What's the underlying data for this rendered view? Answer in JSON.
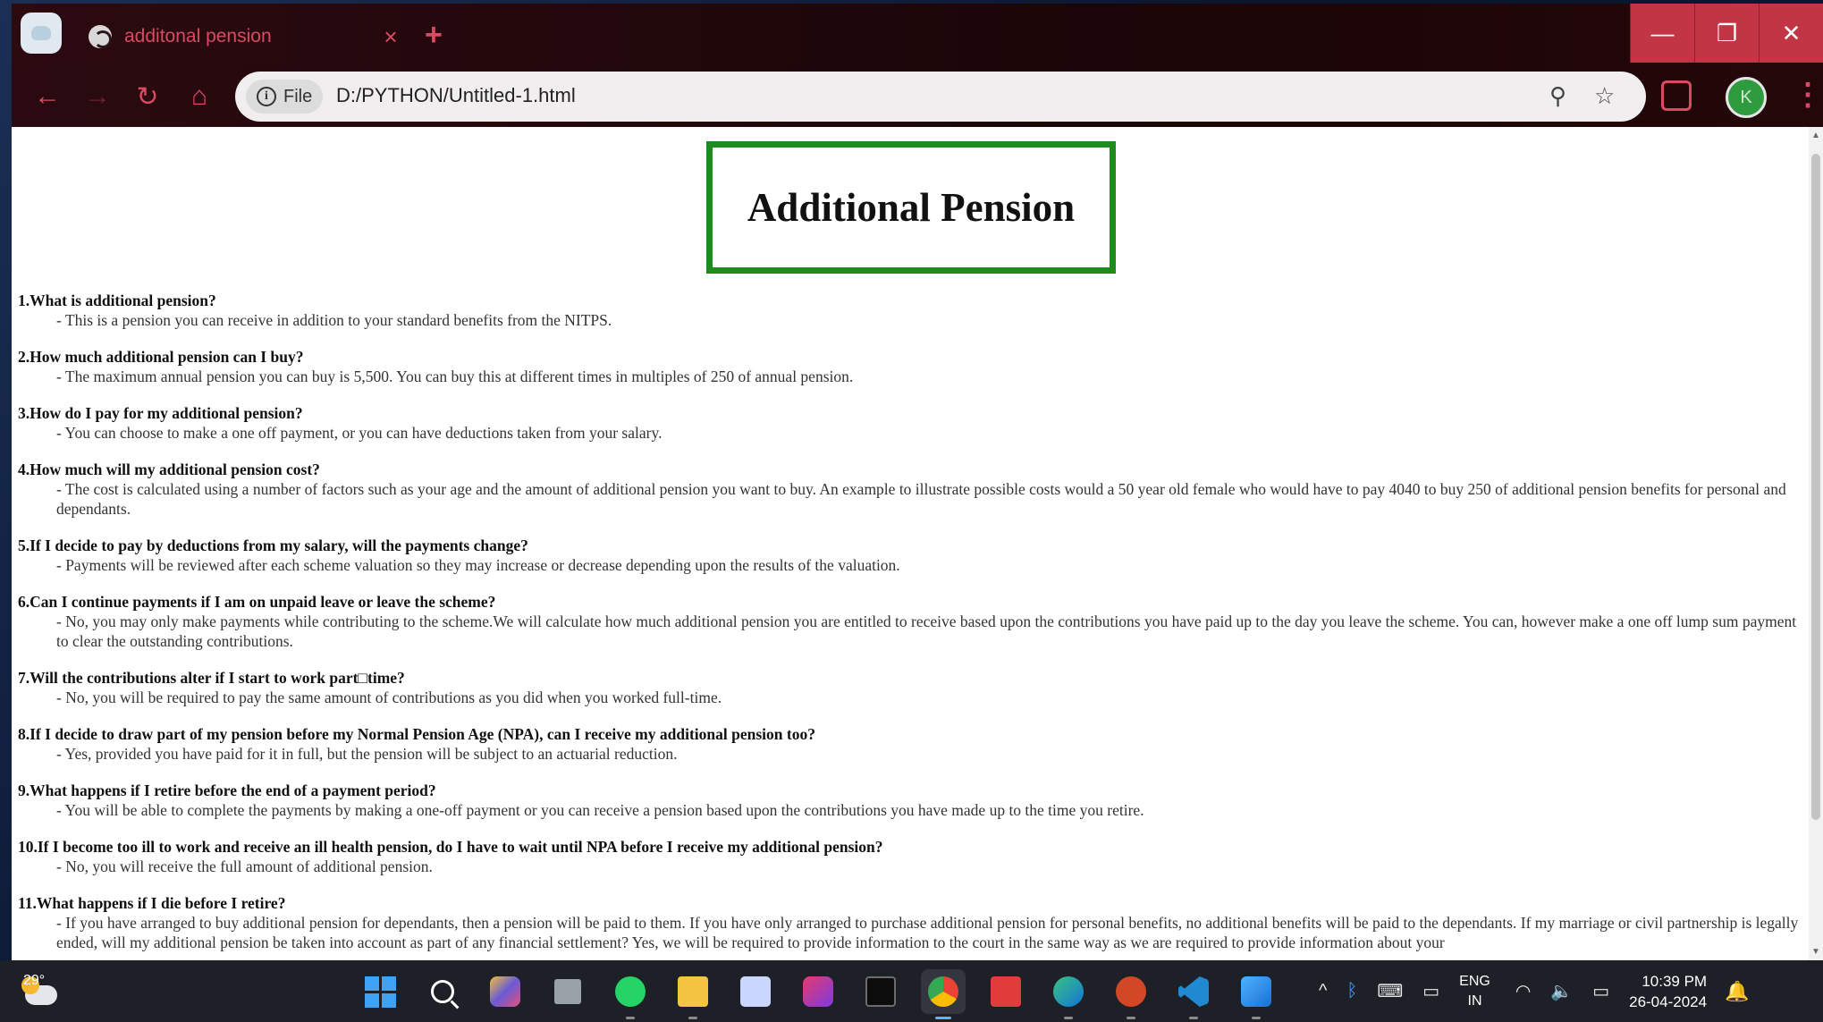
{
  "browser": {
    "tab_title": "additonal pension",
    "tab_close": "×",
    "new_tab": "+",
    "url": "D:/PYTHON/Untitled-1.html",
    "file_chip": "File",
    "info_glyph": "i",
    "profile_initial": "K",
    "window": {
      "minimize": "—",
      "restore": "❐",
      "close": "✕"
    },
    "nav": {
      "back": "←",
      "forward": "→",
      "reload": "↻",
      "home": "⌂"
    },
    "omnibox_icons": {
      "zoom": "⚲",
      "bookmark": "☆"
    },
    "menu": "⋮"
  },
  "page": {
    "heading": "Additional Pension",
    "faqs": [
      {
        "q": "1.What is additional pension?",
        "a": "- This is a pension you can receive in addition to your standard benefits from the NITPS."
      },
      {
        "q": "2.How much additional pension can I buy?",
        "a": "- The maximum annual pension you can buy is 5,500. You can buy this at different times in multiples of 250 of annual pension."
      },
      {
        "q": "3.How do I pay for my additional pension?",
        "a": "- You can choose to make a one off payment, or you can have deductions taken from your salary."
      },
      {
        "q": "4.How much will my additional pension cost?",
        "a": "- The cost is calculated using a number of factors such as your age and the amount of additional pension you want to buy. An example to illustrate possible costs would a 50 year old female who would have to pay 4040 to buy 250 of additional pension benefits for personal and dependants."
      },
      {
        "q": "5.If I decide to pay by deductions from my salary, will the payments change?",
        "a": "- Payments will be reviewed after each scheme valuation so they may increase or decrease depending upon the results of the valuation."
      },
      {
        "q": "6.Can I continue payments if I am on unpaid leave or leave the scheme?",
        "a": "- No, you may only make payments while contributing to the scheme.We will calculate how much additional pension you are entitled to receive based upon the contributions you have paid up to the day you leave the scheme. You can, however make a one off lump sum payment to clear the outstanding contributions."
      },
      {
        "q": "7.Will the contributions alter if I start to work part□time?",
        "a": "- No, you will be required to pay the same amount of contributions as you did when you worked full-time."
      },
      {
        "q": "8.If I decide to draw part of my pension before my Normal Pension Age (NPA), can I receive my additional pension too?",
        "a": "- Yes, provided you have paid for it in full, but the pension will be subject to an actuarial reduction."
      },
      {
        "q": "9.What happens if I retire before the end of a payment period?",
        "a": "- You will be able to complete the payments by making a one-off payment or you can receive a pension based upon the contributions you have made up to the time you retire."
      },
      {
        "q": "10.If I become too ill to work and receive an ill health pension, do I have to wait until NPA before I receive my additional pension?",
        "a": "- No, you will receive the full amount of additional pension."
      },
      {
        "q": "11.What happens if I die before I retire?",
        "a": "- If you have arranged to buy additional pension for dependants, then a pension will be paid to them. If you have only arranged to purchase additional pension for personal benefits, no additional benefits will be paid to the dependants. If my marriage or civil partnership is legally ended, will my additional pension be taken into account as part of any financial settlement? Yes, we will be required to provide information to the court in the same way as we are required to provide information about your"
      }
    ]
  },
  "taskbar": {
    "temperature": "29°",
    "language_top": "ENG",
    "language_bottom": "IN",
    "time": "10:39 PM",
    "date": "26-04-2024",
    "tray_chevron": "^",
    "tray_bluetooth": "ᛒ",
    "tray_keyboard": "⌨",
    "tray_display": "▭",
    "tray_wifi": "◠",
    "tray_volume": "🔈",
    "tray_battery": "▭",
    "notification": "🔔"
  },
  "colors": {
    "accent": "#d94a63",
    "title_border": "#1e8b1e",
    "window_control": "#c13545",
    "taskbar": "#1d2027"
  }
}
